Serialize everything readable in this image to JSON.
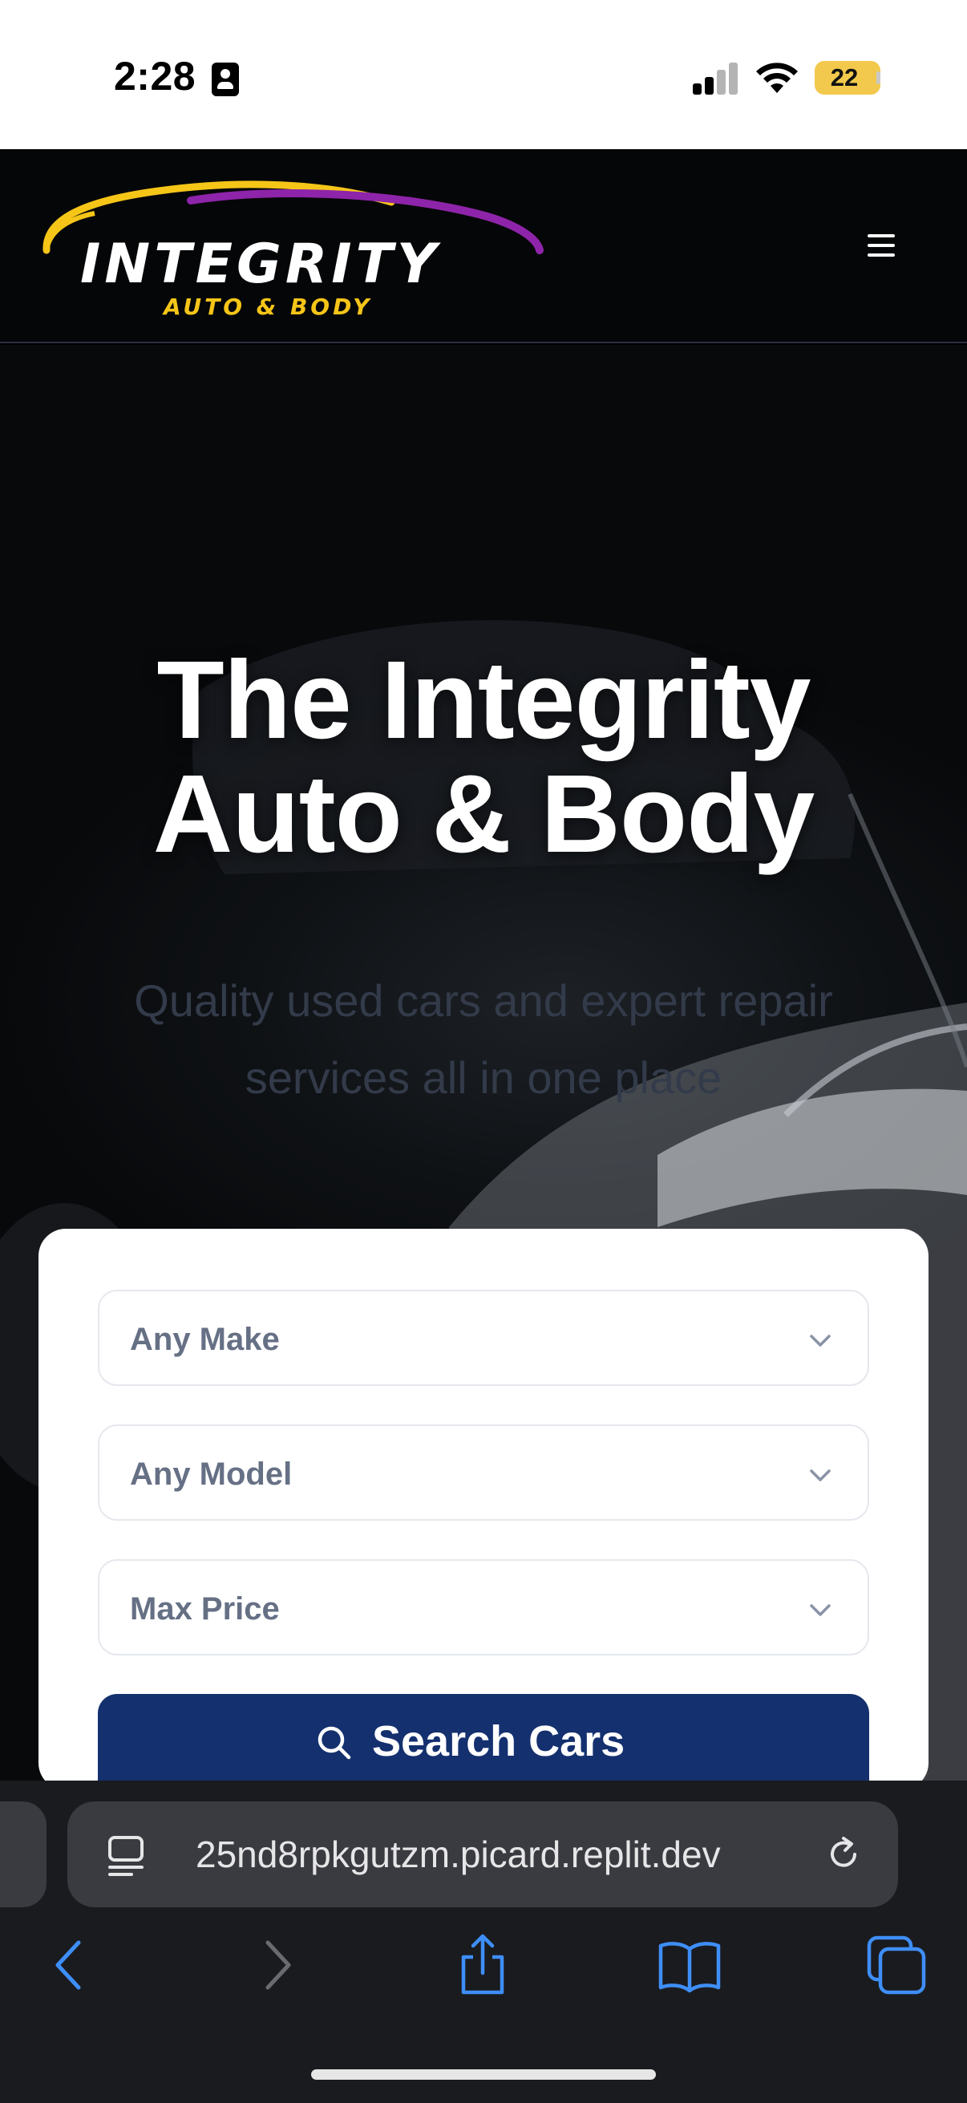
{
  "status_bar": {
    "time": "2:28",
    "battery": "22",
    "icons": [
      "id-card-icon",
      "cellular-signal-icon",
      "wifi-icon",
      "battery-icon"
    ]
  },
  "header": {
    "logo_word": "INTEGRITY",
    "logo_sub": "AUTO & BODY",
    "menu_icon": "hamburger-menu-icon",
    "colors": {
      "logo_gold": "#f5c518",
      "logo_purple": "#8e24aa"
    }
  },
  "hero": {
    "title_line1": "The Integrity",
    "title_line2": "Auto & Body",
    "subtitle": "Quality used cars and expert repair services all in one place"
  },
  "search": {
    "make": {
      "value": "Any Make",
      "icon": "chevron-down-icon"
    },
    "model": {
      "value": "Any Model",
      "icon": "chevron-down-icon"
    },
    "price": {
      "value": "Max Price",
      "icon": "chevron-down-icon"
    },
    "button_label": "Search Cars",
    "button_icon": "search-icon",
    "colors": {
      "button": "#14306e"
    }
  },
  "browser": {
    "url": "25nd8rpkgutzm.picard.replit.dev",
    "icons": [
      "reader-icon",
      "reload-icon",
      "back-icon",
      "forward-icon",
      "share-icon",
      "bookmarks-icon",
      "tabs-icon"
    ],
    "accent": "#3e8ef7"
  }
}
